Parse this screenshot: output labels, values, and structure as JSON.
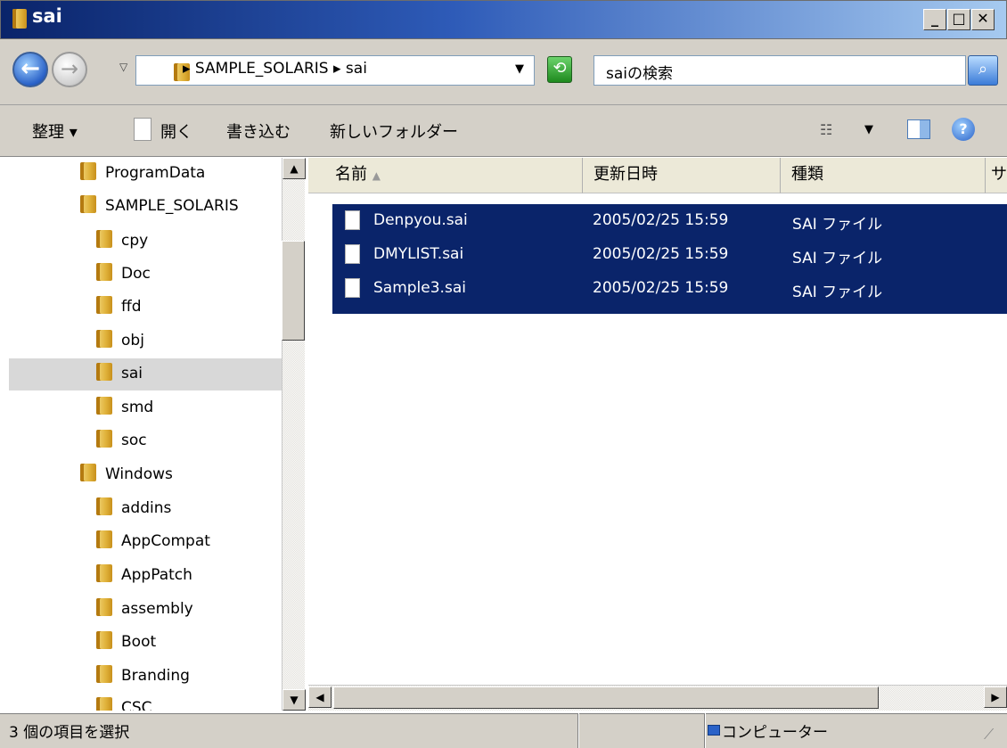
{
  "window": {
    "title": "sai"
  },
  "nav": {
    "address_path": "▸ SAMPLE_SOLARIS ▸ sai",
    "search_placeholder": "saiの検索"
  },
  "toolbar": {
    "organize": "整理 ▾",
    "open": "開く",
    "burn": "書き込む",
    "new_folder": "新しいフォルダー"
  },
  "tree": [
    {
      "label": "ProgramData",
      "indent": 1
    },
    {
      "label": "SAMPLE_SOLARIS",
      "indent": 1
    },
    {
      "label": "cpy",
      "indent": 2
    },
    {
      "label": "Doc",
      "indent": 2
    },
    {
      "label": "ffd",
      "indent": 2
    },
    {
      "label": "obj",
      "indent": 2
    },
    {
      "label": "sai",
      "indent": 2,
      "selected": true
    },
    {
      "label": "smd",
      "indent": 2
    },
    {
      "label": "soc",
      "indent": 2
    },
    {
      "label": "Windows",
      "indent": 1
    },
    {
      "label": "addins",
      "indent": 2
    },
    {
      "label": "AppCompat",
      "indent": 2
    },
    {
      "label": "AppPatch",
      "indent": 2
    },
    {
      "label": "assembly",
      "indent": 2
    },
    {
      "label": "Boot",
      "indent": 2
    },
    {
      "label": "Branding",
      "indent": 2
    },
    {
      "label": "CSC",
      "indent": 2
    }
  ],
  "columns": [
    "名前",
    "更新日時",
    "種類",
    "サ"
  ],
  "files": [
    {
      "name": "Denpyou.sai",
      "date": "2005/02/25 15:59",
      "type": "SAI ファイル"
    },
    {
      "name": "DMYLIST.sai",
      "date": "2005/02/25 15:59",
      "type": "SAI ファイル"
    },
    {
      "name": "Sample3.sai",
      "date": "2005/02/25 15:59",
      "type": "SAI ファイル"
    }
  ],
  "status": {
    "selection": "3 個の項目を選択",
    "location": "コンピューター"
  },
  "colors": {
    "selection": "#0a246a",
    "title_start": "#0a246a",
    "title_end": "#a6caf0"
  }
}
